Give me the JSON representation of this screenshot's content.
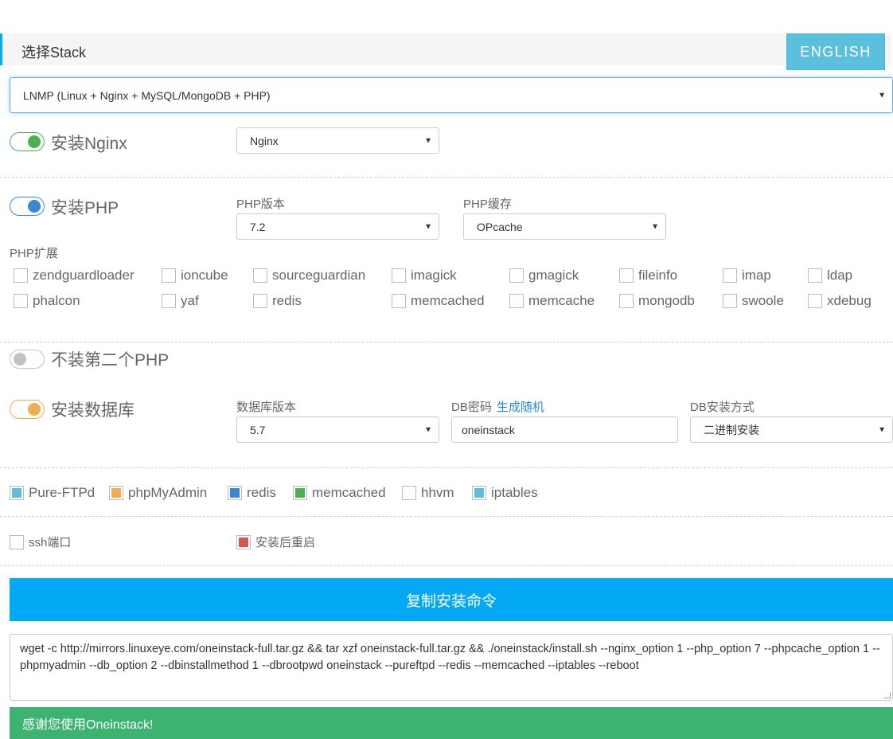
{
  "header": {
    "title": "选择Stack",
    "lang_button": "ENGLISH"
  },
  "stack_select": {
    "value": "LNMP (Linux + Nginx + MySQL/MongoDB + PHP)"
  },
  "nginx": {
    "toggle_label": "安装Nginx",
    "select_value": "Nginx",
    "enabled": true,
    "color": "#4caf50"
  },
  "php": {
    "toggle_label": "安装PHP",
    "enabled": true,
    "color": "#3a87d6",
    "version_label": "PHP版本",
    "version_value": "7.2",
    "cache_label": "PHP缓存",
    "cache_value": "OPcache",
    "ext_label": "PHP扩展",
    "ext_row1": [
      "zendguardloader",
      "ioncube",
      "sourceguardian",
      "imagick",
      "gmagick",
      "fileinfo",
      "imap",
      "ldap"
    ],
    "ext_row2": [
      "phalcon",
      "yaf",
      "redis",
      "memcached",
      "memcache",
      "mongodb",
      "swoole",
      "xdebug"
    ]
  },
  "php2": {
    "toggle_label": "不装第二个PHP",
    "enabled": false,
    "color": "#c0c4c8"
  },
  "database": {
    "toggle_label": "安装数据库",
    "enabled": true,
    "color": "#f0ad4e",
    "version_label": "数据库版本",
    "version_value": "5.7",
    "password_label": "DB密码",
    "password_link": "生成随机",
    "password_value": "oneinstack",
    "method_label": "DB安装方式",
    "method_value": "二进制安装"
  },
  "extras": [
    {
      "label": "Pure-FTPd",
      "checked": true,
      "color": "#5bc0de"
    },
    {
      "label": "phpMyAdmin",
      "checked": true,
      "color": "#f0ad4e"
    },
    {
      "label": "redis",
      "checked": true,
      "color": "#3a87d6"
    },
    {
      "label": "memcached",
      "checked": true,
      "color": "#4caf50"
    },
    {
      "label": "hhvm",
      "checked": false,
      "color": ""
    },
    {
      "label": "iptables",
      "checked": true,
      "color": "#5bc0de"
    }
  ],
  "ssh": {
    "label": "ssh端口",
    "checked": false
  },
  "reboot": {
    "label": "安装后重启",
    "checked": true,
    "color": "#d9534f"
  },
  "copy_button": "复制安装命令",
  "command": "wget -c http://mirrors.linuxeye.com/oneinstack-full.tar.gz && tar xzf oneinstack-full.tar.gz && ./oneinstack/install.sh --nginx_option 1 --php_option 7 --phpcache_option 1 --phpmyadmin  --db_option 2 --dbinstallmethod 1 --dbrootpwd oneinstack --pureftpd  --redis  --memcached  --iptables  --reboot",
  "thanks": "感谢您使用Oneinstack!"
}
